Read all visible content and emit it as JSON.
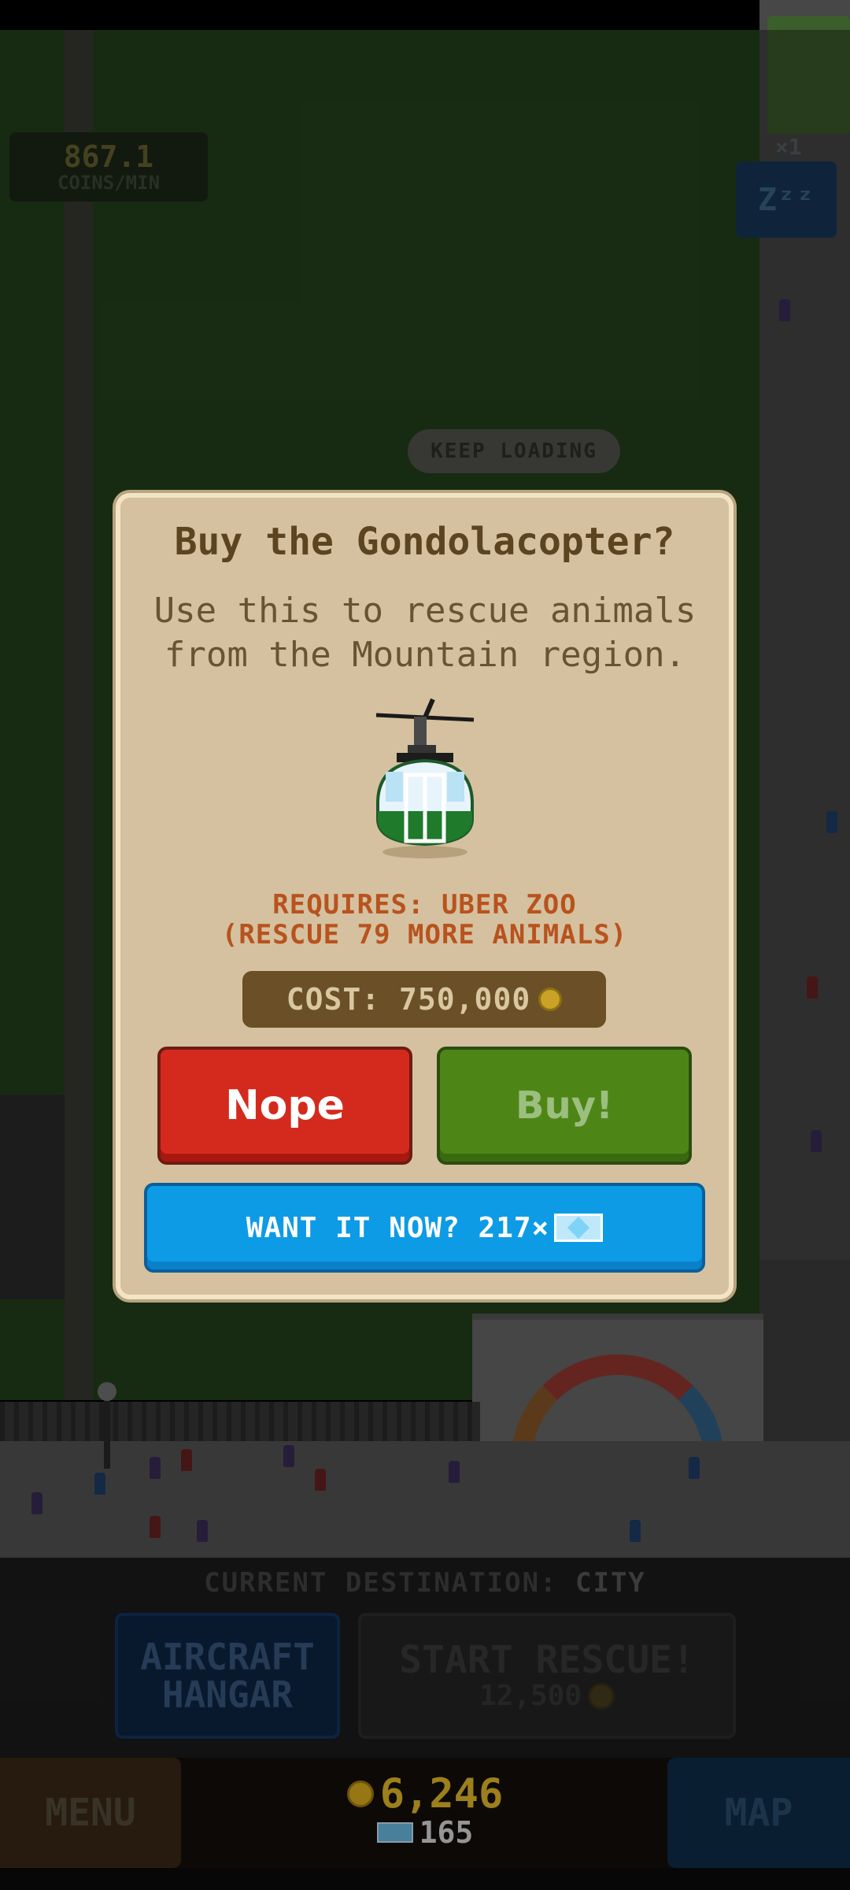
{
  "hud_top": {
    "coins_rate": "867.1",
    "coins_rate_unit": "COINS/MIN",
    "multiplier": "×1",
    "sleep_indicator": "Zᶻᶻ"
  },
  "banner": {
    "keep_loading": "KEEP LOADING"
  },
  "dialog": {
    "title": "Buy the Gondolacopter?",
    "body": "Use this to rescue animals from the Mountain region.",
    "requires_line1": "REQUIRES: UBER ZOO",
    "requires_line2": "(RESCUE 79 MORE ANIMALS)",
    "cost": "COST: 750,000",
    "nope_label": "Nope",
    "buy_label": "Buy!",
    "want_it_now": "WANT IT NOW? 217×"
  },
  "hud_bottom": {
    "destination_label": "CURRENT DESTINATION:",
    "destination_value": "CITY",
    "hangar_line1": "AIRCRAFT",
    "hangar_line2": "HANGAR",
    "start_rescue": "START RESCUE!",
    "start_rescue_cost": "12,500",
    "menu": "MENU",
    "map": "MAP",
    "coins": "6,246",
    "gems": "165"
  },
  "icons": [
    "coin-icon",
    "gem-icon",
    "gondolacopter-icon"
  ],
  "colors": {
    "dialog_bg": "#d5c19f",
    "nope": "#d42a1d",
    "buy": "#4d8616",
    "want_now": "#0d9be6",
    "coin": "#f2c42a"
  }
}
